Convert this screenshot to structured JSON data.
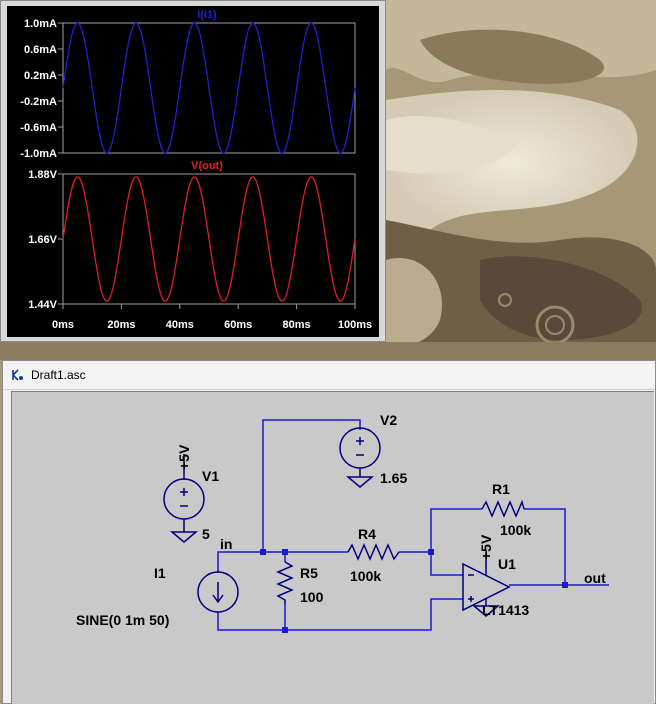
{
  "waveform_viewer": {
    "top_pane": {
      "trace_label": "I(I1)",
      "trace_color": "#2020d0",
      "y_ticks": [
        "1.0mA",
        "0.6mA",
        "0.2mA",
        "-0.2mA",
        "-0.6mA",
        "-1.0mA"
      ]
    },
    "bottom_pane": {
      "trace_label": "V(out)",
      "trace_color": "#e02020",
      "y_ticks": [
        "1.88V",
        "1.66V",
        "1.44V"
      ]
    },
    "x_ticks": [
      "0ms",
      "20ms",
      "40ms",
      "60ms",
      "80ms",
      "100ms"
    ],
    "background": "#000000"
  },
  "chart_data": [
    {
      "type": "line",
      "title": "I(I1)",
      "xlabel": "",
      "ylabel": "",
      "x_unit": "ms",
      "xlim": [
        0,
        100
      ],
      "ylim": [
        -1.0,
        1.0
      ],
      "series": [
        {
          "name": "I(I1)",
          "function": "1.0mA*sin(2*pi*50Hz*t)",
          "amplitude_mA": 1.0,
          "frequency_hz": 50,
          "offset_mA": 0
        }
      ]
    },
    {
      "type": "line",
      "title": "V(out)",
      "xlabel": "",
      "ylabel": "",
      "x_unit": "ms",
      "xlim": [
        0,
        100
      ],
      "ylim": [
        1.44,
        1.88
      ],
      "series": [
        {
          "name": "V(out)",
          "function": "1.65V + 0.2V*sin(2*pi*50Hz*t)",
          "amplitude_V": 0.21,
          "frequency_hz": 50,
          "offset_V": 1.66
        }
      ]
    }
  ],
  "schematic_window": {
    "title": "Draft1.asc",
    "components": {
      "v1": {
        "name": "V1",
        "value": "5",
        "rail": "+5V"
      },
      "v2": {
        "name": "V2",
        "value": "1.65"
      },
      "i1": {
        "name": "I1",
        "value": "SINE(0 1m 50)"
      },
      "r5": {
        "name": "R5",
        "value": "100"
      },
      "r4": {
        "name": "R4",
        "value": "100k"
      },
      "r1": {
        "name": "R1",
        "value": "100k"
      },
      "u1": {
        "name": "U1",
        "value": "LT1413",
        "rail": "+5V"
      }
    },
    "nets": {
      "in": "in",
      "out": "out"
    },
    "wire_color": "#1a1ad0",
    "component_color": "#000080"
  }
}
